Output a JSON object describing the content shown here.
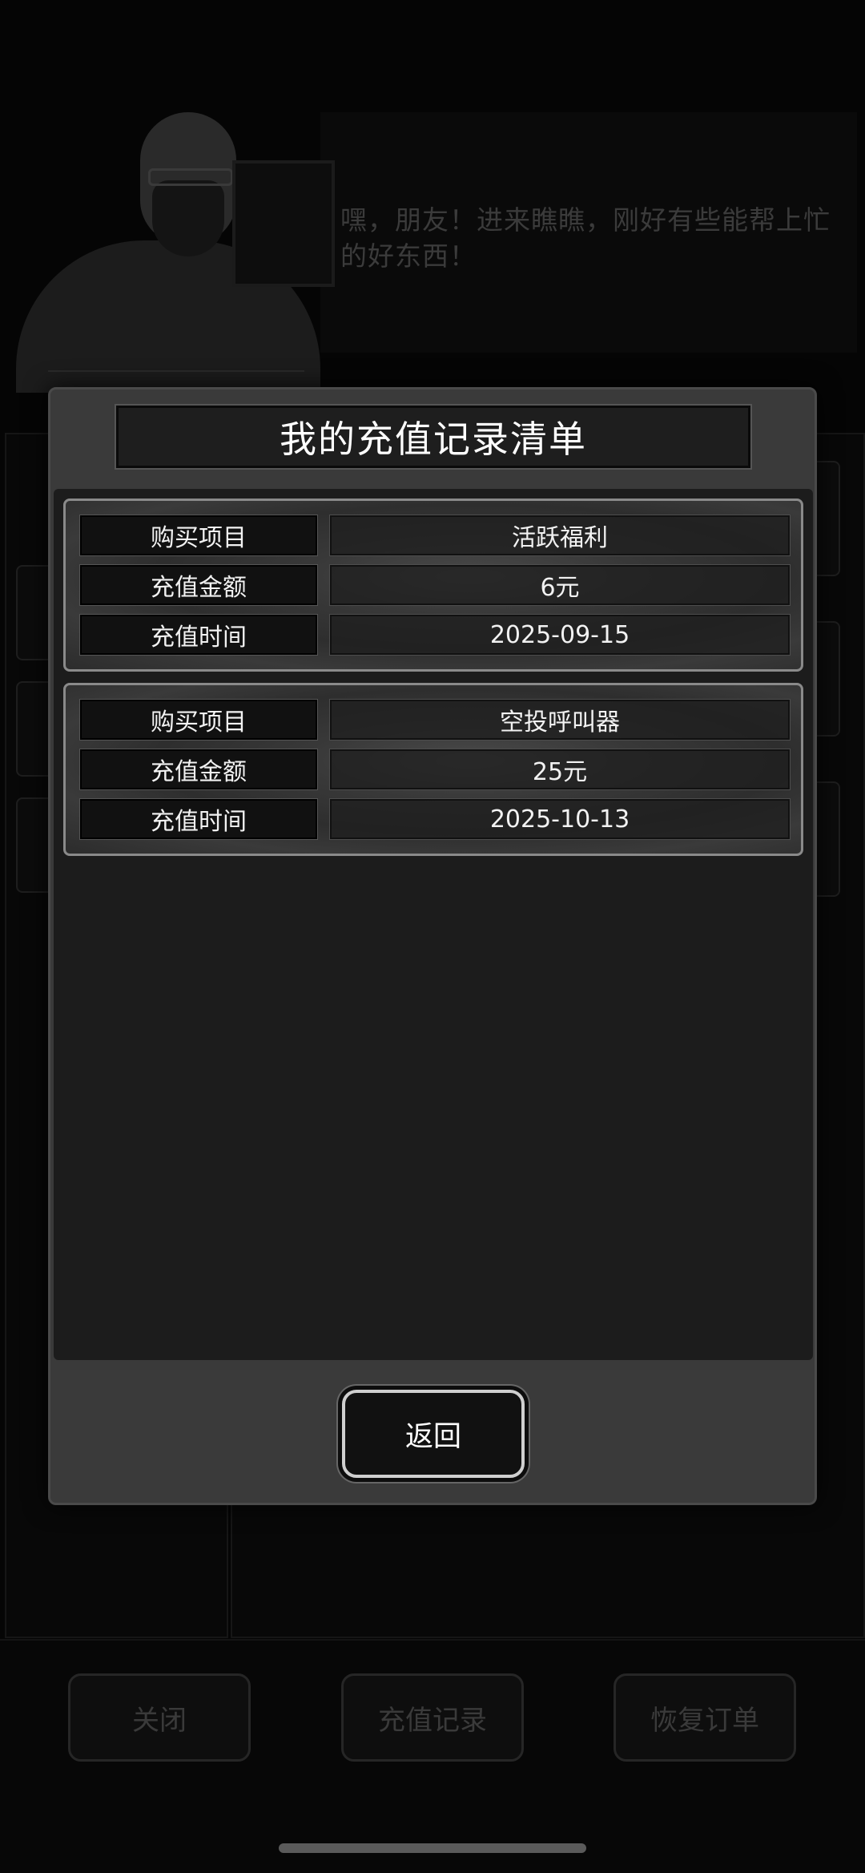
{
  "npc": {
    "dialogue": "嘿，朋友！进来瞧瞧，刚好有些能帮上忙的好东西！"
  },
  "bottom_bar": {
    "buttons": [
      {
        "label": "关闭"
      },
      {
        "label": "充值记录"
      },
      {
        "label": "恢复订单"
      }
    ]
  },
  "modal": {
    "title": "我的充值记录清单",
    "back_label": "返回",
    "records": [
      {
        "rows": [
          {
            "label": "购买项目",
            "value": "活跃福利"
          },
          {
            "label": "充值金额",
            "value": "6元"
          },
          {
            "label": "充值时间",
            "value": "2025-09-15"
          }
        ]
      },
      {
        "rows": [
          {
            "label": "购买项目",
            "value": "空投呼叫器"
          },
          {
            "label": "充值金额",
            "value": "25元"
          },
          {
            "label": "充值时间",
            "value": "2025-10-13"
          }
        ]
      }
    ]
  }
}
